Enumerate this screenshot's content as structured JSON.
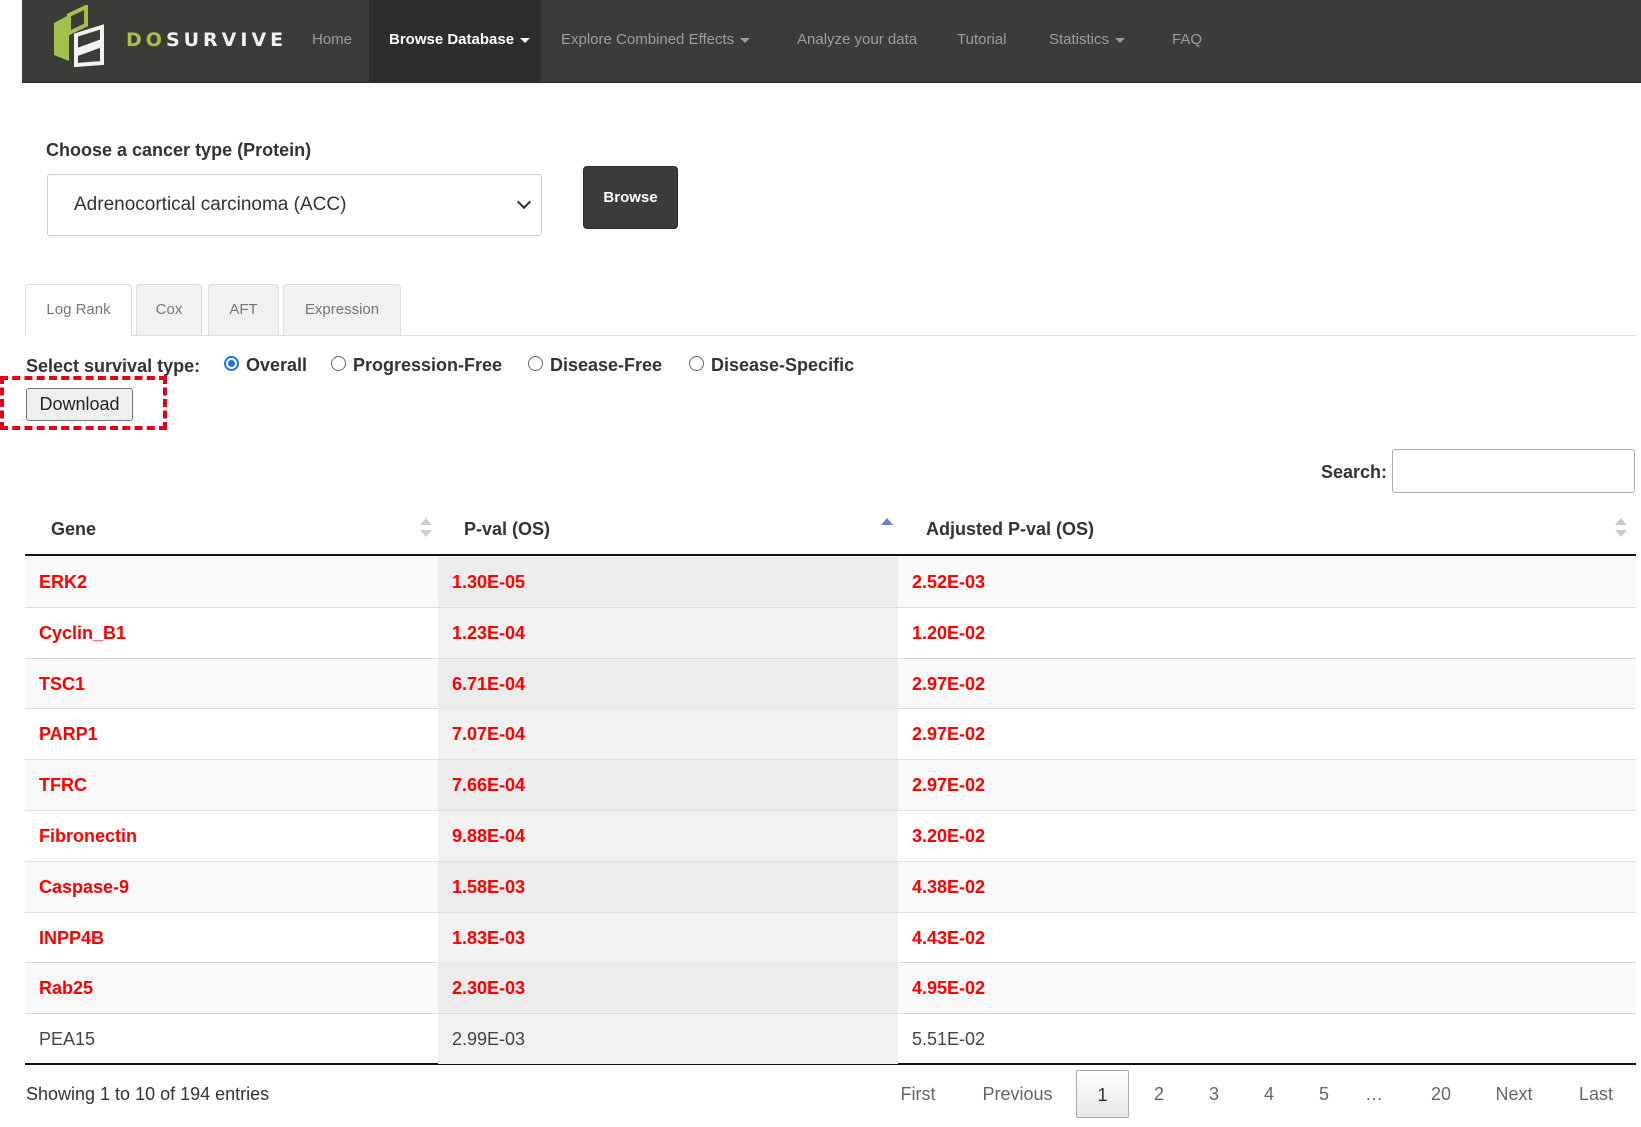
{
  "navbar": {
    "brand_prefix": "DO",
    "brand_suffix": "SURVIVE",
    "items": [
      {
        "label": "Home"
      },
      {
        "label": "Browse Database"
      },
      {
        "label": "Explore Combined Effects"
      },
      {
        "label": "Analyze your data"
      },
      {
        "label": "Tutorial"
      },
      {
        "label": "Statistics"
      },
      {
        "label": "FAQ"
      }
    ],
    "active": "Browse Database"
  },
  "chooser": {
    "label": "Choose a cancer type (Protein)",
    "selected": "Adrenocortical carcinoma (ACC)",
    "browse_label": "Browse"
  },
  "tabs": [
    {
      "label": "Log Rank"
    },
    {
      "label": "Cox"
    },
    {
      "label": "AFT"
    },
    {
      "label": "Expression"
    }
  ],
  "survival": {
    "label": "Select survival type:",
    "options": [
      {
        "label": "Overall",
        "checked": true
      },
      {
        "label": "Progression-Free",
        "checked": false
      },
      {
        "label": "Disease-Free",
        "checked": false
      },
      {
        "label": "Disease-Specific",
        "checked": false
      }
    ]
  },
  "download_label": "Download",
  "search": {
    "label": "Search:",
    "value": ""
  },
  "table": {
    "columns": [
      "Gene",
      "P-val (OS)",
      "Adjusted P-val (OS)"
    ],
    "sorted_column": "P-val (OS)",
    "rows": [
      {
        "gene": "ERK2",
        "pval": "1.30E-05",
        "adj": "2.52E-03",
        "significant": true
      },
      {
        "gene": "Cyclin_B1",
        "pval": "1.23E-04",
        "adj": "1.20E-02",
        "significant": true
      },
      {
        "gene": "TSC1",
        "pval": "6.71E-04",
        "adj": "2.97E-02",
        "significant": true
      },
      {
        "gene": "PARP1",
        "pval": "7.07E-04",
        "adj": "2.97E-02",
        "significant": true
      },
      {
        "gene": "TFRC",
        "pval": "7.66E-04",
        "adj": "2.97E-02",
        "significant": true
      },
      {
        "gene": "Fibronectin",
        "pval": "9.88E-04",
        "adj": "3.20E-02",
        "significant": true
      },
      {
        "gene": "Caspase-9",
        "pval": "1.58E-03",
        "adj": "4.38E-02",
        "significant": true
      },
      {
        "gene": "INPP4B",
        "pval": "1.83E-03",
        "adj": "4.43E-02",
        "significant": true
      },
      {
        "gene": "Rab25",
        "pval": "2.30E-03",
        "adj": "4.95E-02",
        "significant": true
      },
      {
        "gene": "PEA15",
        "pval": "2.99E-03",
        "adj": "5.51E-02",
        "significant": false
      }
    ]
  },
  "footer": {
    "info": "Showing 1 to 10 of 194 entries",
    "pagination": [
      "First",
      "Previous",
      "1",
      "2",
      "3",
      "4",
      "5",
      "…",
      "20",
      "Next",
      "Last"
    ],
    "current_page": "1"
  },
  "colors": {
    "navbar": "#3b3b38",
    "brand_accent": "#a3c14a",
    "significant": "#ff0000",
    "highlight_box": "#e3001b"
  }
}
